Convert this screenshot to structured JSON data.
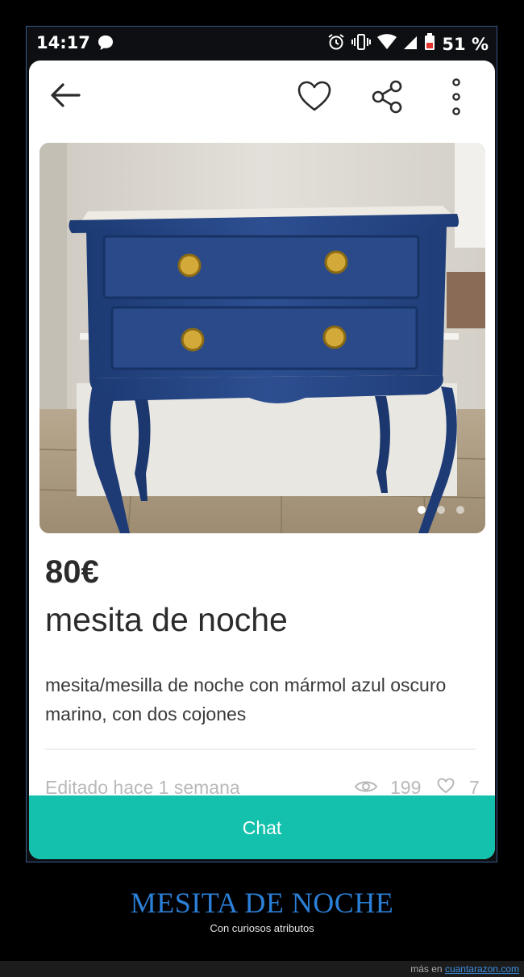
{
  "status_bar": {
    "time": "14:17",
    "battery_percent": "51 %"
  },
  "listing": {
    "price": "80€",
    "title": "mesita de noche",
    "description": "mesita/mesilla de noche con mármol azul oscuro marino, con dos cojones",
    "edited": "Editado hace 1 semana",
    "views": "199",
    "likes": "7",
    "photo_count": 3,
    "active_photo": 1
  },
  "actions": {
    "chat_label": "Chat"
  },
  "caption": {
    "title": "MESITA DE NOCHE",
    "subtitle": "Con curiosos atributos"
  },
  "footer": {
    "prefix": "más en",
    "site": "cuantarazon.com"
  },
  "colors": {
    "accent": "#13c1ac",
    "caption_title": "#2b7fd6"
  }
}
